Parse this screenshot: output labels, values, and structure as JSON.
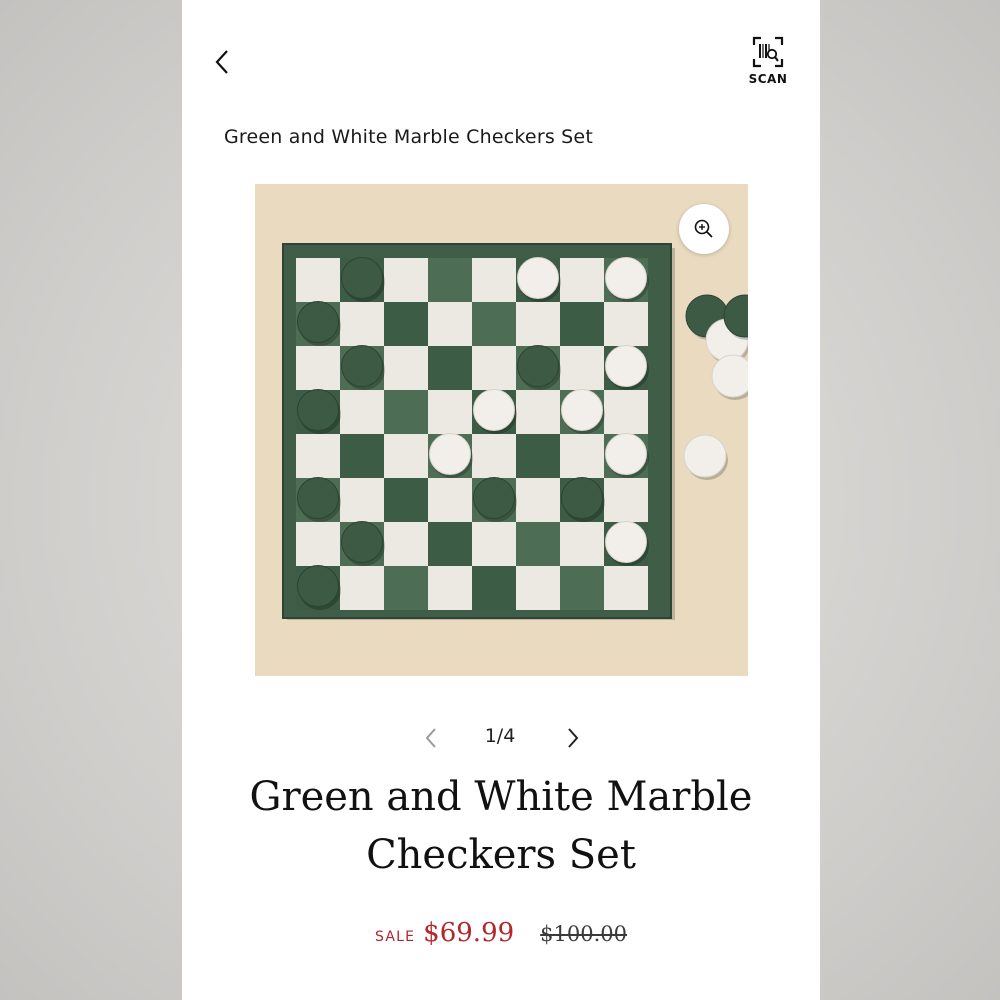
{
  "header": {
    "back_icon": "chevron-left-icon",
    "scan_icon": "barcode-scan-icon",
    "scan_label": "SCAN"
  },
  "breadcrumb_title": "Green and White Marble Checkers Set",
  "image": {
    "zoom_icon": "zoom-in-icon",
    "description_colors": {
      "background": "#e9dac0",
      "board_green": "#3f5d47",
      "board_white": "#ece9e3",
      "piece_green": "#3d5a44",
      "piece_white": "#f2efea"
    }
  },
  "pager": {
    "prev_icon": "chevron-left-icon",
    "next_icon": "chevron-right-icon",
    "count": "1/4"
  },
  "product": {
    "title_line1": "Green and White Marble",
    "title_line2": "Checkers Set"
  },
  "price": {
    "sale_label": "SALE",
    "sale_price": "$69.99",
    "original_price": "$100.00",
    "sale_color": "#b3262b"
  }
}
